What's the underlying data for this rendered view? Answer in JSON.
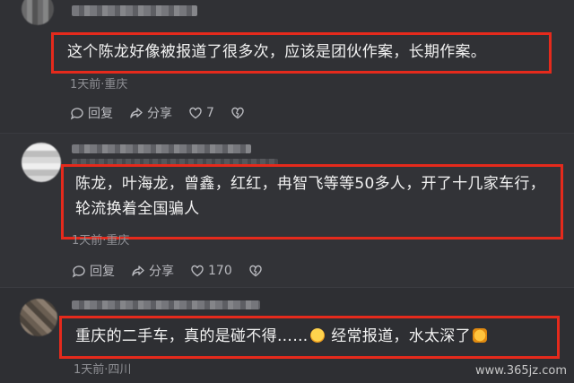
{
  "comments": [
    {
      "text": "这个陈龙好像被报道了很多次，应该是团伙作案，长期作案。",
      "meta": "1天前·重庆",
      "reply_label": "回复",
      "share_label": "分享",
      "like_count": "7"
    },
    {
      "text": "陈龙，叶海龙，曾鑫，红红，冉智飞等等50多人，开了十几家车行，轮流换着全国骗人",
      "meta": "1天前·重庆",
      "reply_label": "回复",
      "share_label": "分享",
      "like_count": "170"
    },
    {
      "text_before_emoji": "重庆的二手车，真的是碰不得……",
      "text_after_emoji": " 经常报道，水太深了",
      "meta": "1天前·四川"
    }
  ],
  "watermark": "www.365jz.com",
  "icons": [
    "reply-icon",
    "share-icon",
    "like-icon",
    "dislike-icon",
    "laugh-emoji-icon",
    "thumbs-up-emoji-icon"
  ],
  "colors": {
    "highlight": "#e52a1c",
    "background": "#2b2c30"
  }
}
